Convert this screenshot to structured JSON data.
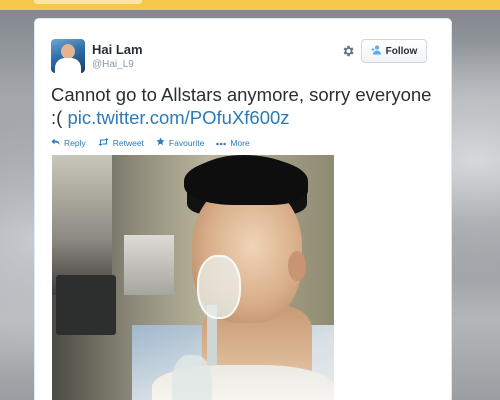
{
  "tweet": {
    "author_name": "Hai Lam",
    "author_handle": "@Hai_L9",
    "text": "Cannot go to Allstars anymore, sorry everyone :( ",
    "link_text": "pic.twitter.com/POfuXf600z"
  },
  "header": {
    "settings_icon": "gear-icon",
    "follow_label": "Follow"
  },
  "actions": {
    "reply": "Reply",
    "retweet": "Retweet",
    "favourite": "Favourite",
    "more": "More"
  },
  "colors": {
    "link": "#2b7bb9",
    "text": "#292f33",
    "muted": "#8899a6",
    "top_bar": "#f5c84c"
  }
}
